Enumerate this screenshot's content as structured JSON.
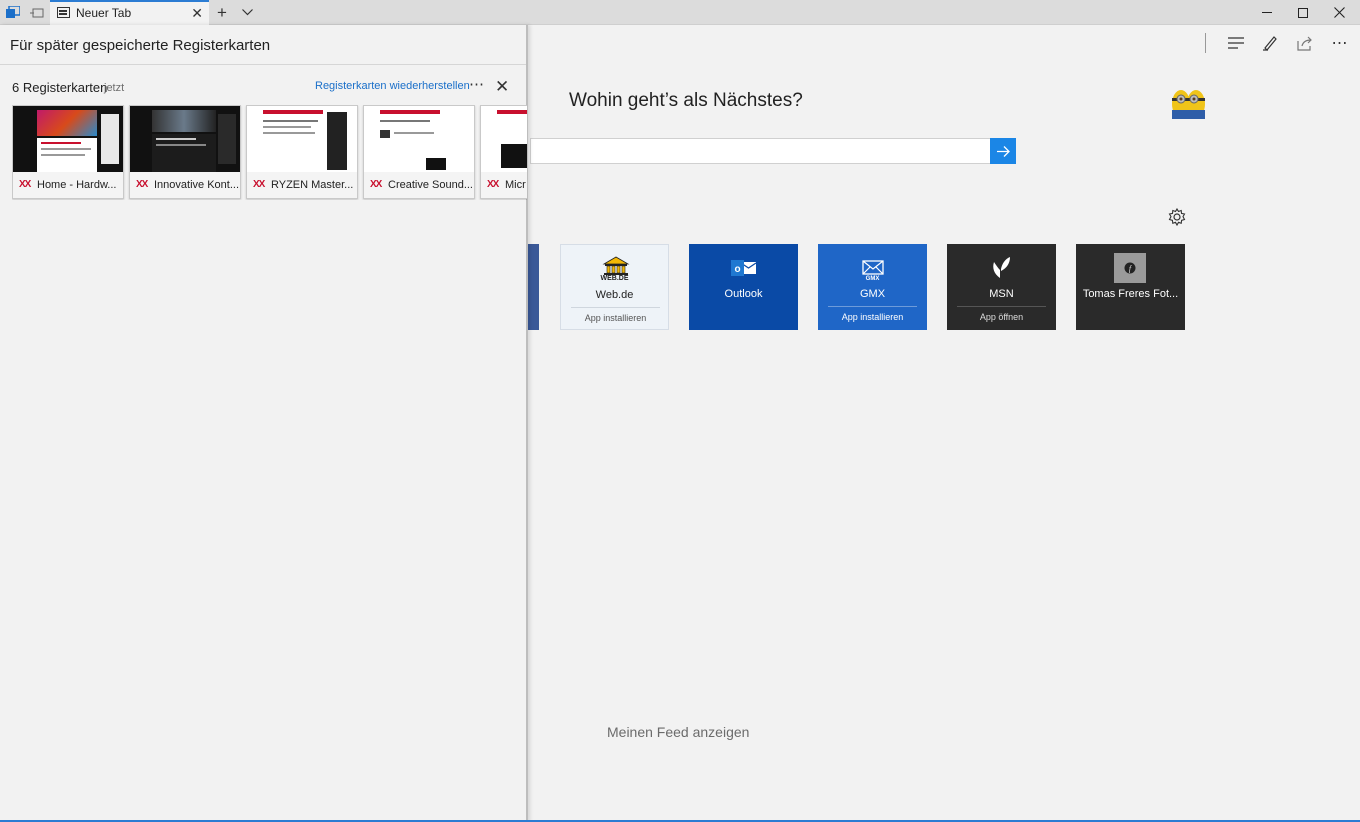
{
  "titlebar": {
    "active_tab_title": "Neuer Tab"
  },
  "panel": {
    "title": "Für später gespeicherte Registerkarten",
    "group_count": "6 Registerkarten",
    "group_time": "jetzt",
    "restore_label": "Registerkarten wiederherstellen",
    "tabs": [
      {
        "label": "Home - Hardw..."
      },
      {
        "label": "Innovative Kont..."
      },
      {
        "label": "RYZEN Master..."
      },
      {
        "label": "Creative Sound..."
      },
      {
        "label": "Micr"
      }
    ]
  },
  "main": {
    "heading": "Wohin geht’s als Nächstes?",
    "search_placeholder": "",
    "tiles": [
      {
        "name": "Web.de",
        "sub": "App installieren",
        "logo_text": "WEB.DE",
        "bg": "#eef3f8"
      },
      {
        "name": "Outlook",
        "sub": "",
        "bg": "#0a4aa6"
      },
      {
        "name": "GMX",
        "sub": "App installieren",
        "logo_text": "GMX",
        "bg": "#1f66c7"
      },
      {
        "name": "MSN",
        "sub": "App öffnen",
        "bg": "#2a2a2a"
      },
      {
        "name": "Tomas Freres Fot...",
        "sub": "",
        "bg": "#2a2a2a"
      }
    ],
    "feed_label": "Meinen Feed anzeigen"
  },
  "colors": {
    "accent": "#1b86e6",
    "link": "#1a6fc9",
    "pcgh_red": "#c8102e"
  }
}
